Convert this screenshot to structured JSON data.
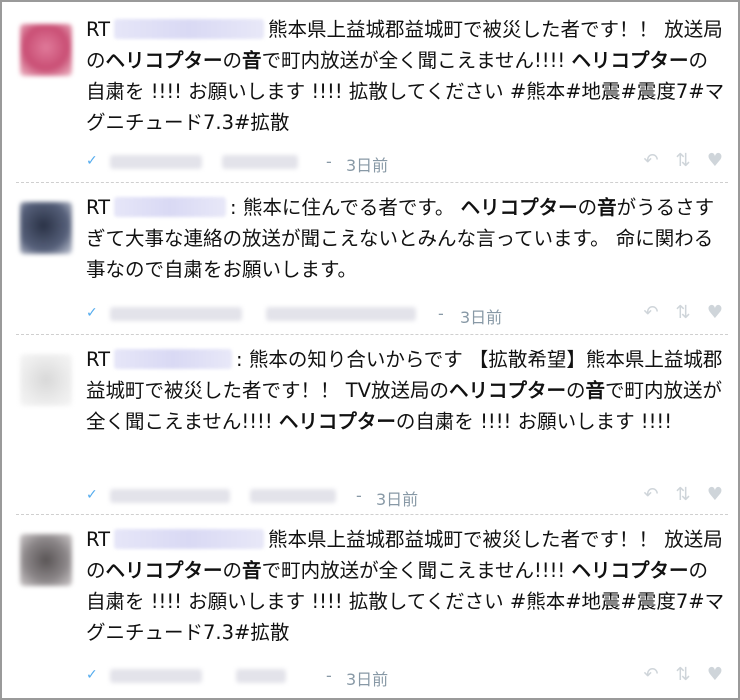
{
  "tweets": [
    {
      "prefix": "RT",
      "text": [
        {
          "t": "熊本県上益城郡益城町で被災した者です！！ 放送局の",
          "b": false
        },
        {
          "t": "ヘリコプター",
          "b": true
        },
        {
          "t": "の",
          "b": false
        },
        {
          "t": "音",
          "b": true
        },
        {
          "t": "で町内放送が全く聞こえません!!!! ",
          "b": false
        },
        {
          "t": "ヘリコプター",
          "b": true
        },
        {
          "t": "の自粛を !!!! お願いします !!!! 拡散してください #熊本#地震#震度7#マグニチュード7.3#拡散",
          "b": false
        }
      ],
      "separator": "-",
      "time": "3日前"
    },
    {
      "prefix": "RT",
      "text": [
        {
          "t": ": 熊本に住んでる者です。 ",
          "b": false
        },
        {
          "t": "ヘリコプター",
          "b": true
        },
        {
          "t": "の",
          "b": false
        },
        {
          "t": "音",
          "b": true
        },
        {
          "t": "がうるさすぎて大事な連絡の放送が聞こえないとみんな言っています。 命に関わる事なので自粛をお願いします。",
          "b": false
        }
      ],
      "separator": "-",
      "time": "3日前"
    },
    {
      "prefix": "RT",
      "text": [
        {
          "t": ": 熊本の知り合いからです 【拡散希望】熊本県上益城郡益城町で被災した者です！！ TV放送局の",
          "b": false
        },
        {
          "t": "ヘリコプター",
          "b": true
        },
        {
          "t": "の",
          "b": false
        },
        {
          "t": "音",
          "b": true
        },
        {
          "t": "で町内放送が全く聞こえません!!!! ",
          "b": false
        },
        {
          "t": "ヘリコプター",
          "b": true
        },
        {
          "t": "の自粛を !!!! お願いします !!!!",
          "b": false
        }
      ],
      "separator": "-",
      "time": "3日前"
    },
    {
      "prefix": "RT",
      "text": [
        {
          "t": "熊本県上益城郡益城町で被災した者です！！ 放送局の",
          "b": false
        },
        {
          "t": "ヘリコプター",
          "b": true
        },
        {
          "t": "の",
          "b": false
        },
        {
          "t": "音",
          "b": true
        },
        {
          "t": "で町内放送が全く聞こえません!!!! ",
          "b": false
        },
        {
          "t": "ヘリコプター",
          "b": true
        },
        {
          "t": "の自粛を !!!! お願いします !!!! 拡散してください #熊本#地震#震度7#マグニチュード7.3#拡散",
          "b": false
        }
      ],
      "separator": "-",
      "time": "3日前"
    }
  ],
  "icons": {
    "source": "twitter-bird-icon",
    "reply": "reply-icon",
    "retweet": "retweet-icon",
    "favorite": "heart-icon"
  },
  "colors": {
    "twitter_blue": "#55acee",
    "meta_gray": "#8899a6",
    "action_gray": "#cfd5da"
  }
}
